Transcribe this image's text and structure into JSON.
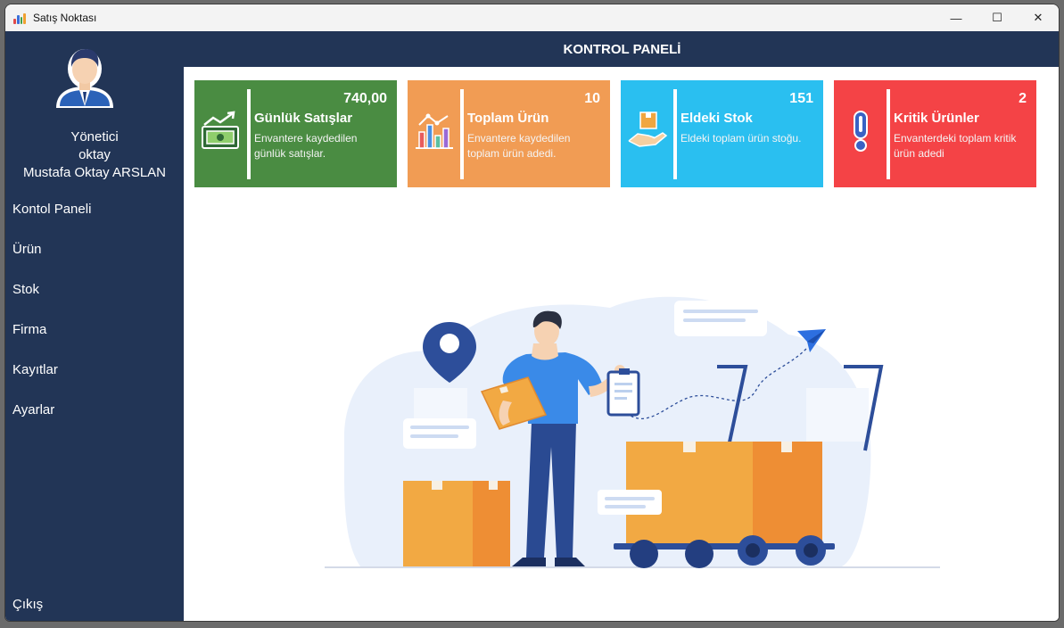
{
  "window": {
    "title": "Satış Noktası",
    "controls": {
      "minimize": "—",
      "maximize": "☐",
      "close": "✕"
    }
  },
  "sidebar": {
    "role": "Yönetici",
    "username": "oktay",
    "fullname": "Mustafa Oktay ARSLAN",
    "items": [
      {
        "label": "Kontol Paneli"
      },
      {
        "label": "Ürün"
      },
      {
        "label": "Stok"
      },
      {
        "label": "Firma"
      },
      {
        "label": "Kayıtlar"
      },
      {
        "label": "Ayarlar"
      }
    ],
    "logout": "Çıkış"
  },
  "header": {
    "title": "KONTROL PANELİ"
  },
  "cards": [
    {
      "value": "740,00",
      "title": "Günlük Satışlar",
      "desc": "Envantere kaydedilen günlük satışlar.",
      "color": "#4a8c42",
      "icon": "money-growth-icon"
    },
    {
      "value": "10",
      "title": "Toplam Ürün",
      "desc": "Envantere kaydedilen toplam ürün adedi.",
      "color": "#f19c54",
      "icon": "bar-chart-icon"
    },
    {
      "value": "151",
      "title": "Eldeki Stok",
      "desc": "Eldeki toplam ürün stoğu.",
      "color": "#2abff0",
      "icon": "hand-box-icon"
    },
    {
      "value": "2",
      "title": "Kritik Ürünler",
      "desc": "Envanterdeki toplam kritik ürün adedi",
      "color": "#f44346",
      "icon": "exclamation-icon"
    }
  ],
  "colors": {
    "sidebar": "#223556",
    "titlebar": "#f3f3f3",
    "content": "#ffffff"
  }
}
